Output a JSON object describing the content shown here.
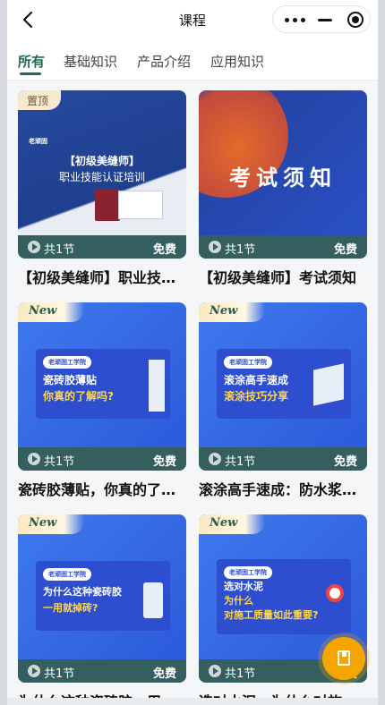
{
  "header": {
    "title": "课程"
  },
  "tabs": [
    {
      "label": "所有",
      "active": true
    },
    {
      "label": "基础知识"
    },
    {
      "label": "产品介绍"
    },
    {
      "label": "应用知识"
    }
  ],
  "cards": [
    {
      "badge": "置顶",
      "banner_line1": "【初级美缝师】",
      "banner_line2": "职业技能认证培训",
      "brand": "老顽固",
      "count": "共1节",
      "price": "免费",
      "title": "【初级美缝师】职业技…"
    },
    {
      "banner_line1": "考试须知",
      "count": "共1节",
      "price": "免费",
      "title": "【初级美缝师】考试须知"
    },
    {
      "badge": "New",
      "brand": "老顽固工学院",
      "banner_line1": "瓷砖胶薄贴",
      "banner_line2": "你真的了解吗?",
      "count": "共1节",
      "price": "免费",
      "title": "瓷砖胶薄贴，你真的了…"
    },
    {
      "badge": "New",
      "brand": "老顽固工学院",
      "banner_line1": "滚涂高手速成",
      "banner_line2": "滚涂技巧分享",
      "count": "共1节",
      "price": "免费",
      "title": "滚涂高手速成：防水浆…"
    },
    {
      "badge": "New",
      "brand": "老顽固工学院",
      "banner_line1": "为什么这种瓷砖胶",
      "banner_line2": "一用就掉砖?",
      "count": "共1节",
      "price": "免费",
      "title": "为什么这种瓷砖胶一用…"
    },
    {
      "badge": "New",
      "brand": "老顽固工学院",
      "banner_line1": "选对水泥",
      "banner_line2": "为什么",
      "banner_line3": "对施工质量如此重要?",
      "count": "共1节",
      "price": "免费",
      "title": "选对水泥，为什么对施…"
    }
  ],
  "colors": {
    "accent": "#1f6b55",
    "fab": "#f5a500",
    "meta_bar": "#355f5e"
  },
  "icons": {
    "back": "chevron-left-icon",
    "more": "more-dots-icon",
    "minimize": "minus-icon",
    "close": "target-icon",
    "fab": "book-icon"
  }
}
